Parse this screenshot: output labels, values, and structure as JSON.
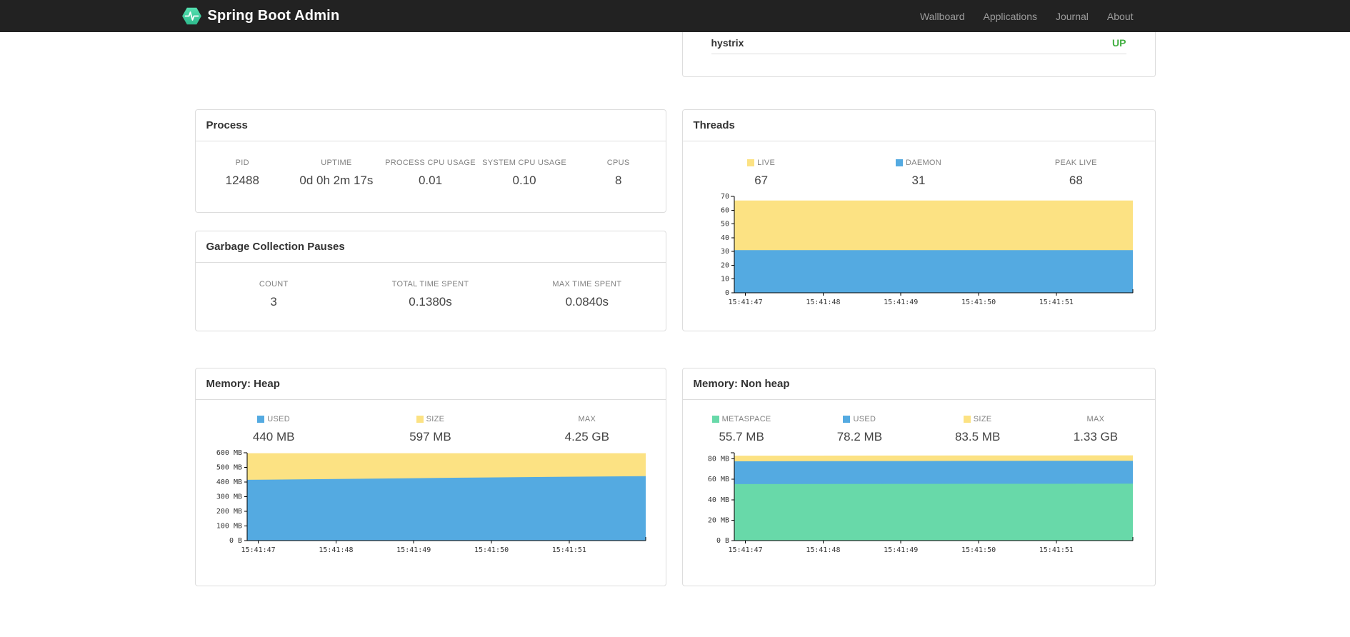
{
  "navbar": {
    "brand": "Spring Boot Admin",
    "items": [
      {
        "label": "Wallboard"
      },
      {
        "label": "Applications"
      },
      {
        "label": "Journal"
      },
      {
        "label": "About"
      }
    ]
  },
  "colors": {
    "navbar_bg": "#222222",
    "logo_green": "#41cda2",
    "status_up": "#44b044",
    "yellow": "#fce283",
    "blue": "#54aae1",
    "green": "#68d9a9",
    "panel_border": "#dddddd"
  },
  "application_panel": {
    "name": "hystrix",
    "status": "UP"
  },
  "process": {
    "title": "Process",
    "stats": [
      {
        "label": "PID",
        "value": "12488"
      },
      {
        "label": "UPTIME",
        "value": "0d 0h 2m 17s"
      },
      {
        "label": "PROCESS CPU USAGE",
        "value": "0.01"
      },
      {
        "label": "SYSTEM CPU USAGE",
        "value": "0.10"
      },
      {
        "label": "CPUS",
        "value": "8"
      }
    ]
  },
  "gc": {
    "title": "Garbage Collection Pauses",
    "stats": [
      {
        "label": "COUNT",
        "value": "3"
      },
      {
        "label": "TOTAL TIME SPENT",
        "value": "0.1380s"
      },
      {
        "label": "MAX TIME SPENT",
        "value": "0.0840s"
      }
    ]
  },
  "threads": {
    "title": "Threads",
    "stats": [
      {
        "label": "LIVE",
        "value": "67",
        "swatch": "#fce283"
      },
      {
        "label": "DAEMON",
        "value": "31",
        "swatch": "#54aae1"
      },
      {
        "label": "PEAK LIVE",
        "value": "68"
      }
    ]
  },
  "heap": {
    "title": "Memory: Heap",
    "stats": [
      {
        "label": "USED",
        "value": "440 MB",
        "swatch": "#54aae1"
      },
      {
        "label": "SIZE",
        "value": "597 MB",
        "swatch": "#fce283"
      },
      {
        "label": "MAX",
        "value": "4.25 GB"
      }
    ]
  },
  "nonheap": {
    "title": "Memory: Non heap",
    "stats": [
      {
        "label": "METASPACE",
        "value": "55.7 MB",
        "swatch": "#68d9a9"
      },
      {
        "label": "USED",
        "value": "78.2 MB",
        "swatch": "#54aae1"
      },
      {
        "label": "SIZE",
        "value": "83.5 MB",
        "swatch": "#fce283"
      },
      {
        "label": "MAX",
        "value": "1.33 GB"
      }
    ]
  },
  "chart_data": [
    {
      "id": "threads",
      "type": "area",
      "title": "Threads",
      "ymax": 70,
      "legend_position": "top",
      "grid": false,
      "y_ticks": [
        {
          "label": "70",
          "value": 70
        },
        {
          "label": "60",
          "value": 60
        },
        {
          "label": "50",
          "value": 50
        },
        {
          "label": "40",
          "value": 40
        },
        {
          "label": "30",
          "value": 30
        },
        {
          "label": "20",
          "value": 20
        },
        {
          "label": "10",
          "value": 10
        },
        {
          "label": "0",
          "value": 0
        }
      ],
      "x_ticks": [
        "15:41:47",
        "15:41:48",
        "15:41:49",
        "15:41:50",
        "15:41:51"
      ],
      "series": [
        {
          "name": "live",
          "color": "#fce283",
          "values": [
            67,
            67,
            67,
            67,
            67,
            67
          ]
        },
        {
          "name": "daemon",
          "color": "#54aae1",
          "values": [
            31,
            31,
            31,
            31,
            31,
            31
          ]
        }
      ]
    },
    {
      "id": "heap",
      "type": "area",
      "title": "Memory: Heap",
      "ymax": 600,
      "legend_position": "top",
      "grid": false,
      "y_ticks": [
        {
          "label": "600 MB",
          "value": 600
        },
        {
          "label": "500 MB",
          "value": 500
        },
        {
          "label": "400 MB",
          "value": 400
        },
        {
          "label": "300 MB",
          "value": 300
        },
        {
          "label": "200 MB",
          "value": 200
        },
        {
          "label": "100 MB",
          "value": 100
        },
        {
          "label": "0 B",
          "value": 0
        }
      ],
      "x_ticks": [
        "15:41:47",
        "15:41:48",
        "15:41:49",
        "15:41:50",
        "15:41:51"
      ],
      "series": [
        {
          "name": "size",
          "color": "#fce283",
          "values": [
            597,
            597,
            597,
            597,
            597,
            597
          ]
        },
        {
          "name": "used",
          "color": "#54aae1",
          "values": [
            415,
            420,
            426,
            431,
            436,
            440
          ]
        }
      ]
    },
    {
      "id": "nonheap",
      "type": "area",
      "title": "Memory: Non heap",
      "ymax": 86,
      "legend_position": "top",
      "grid": false,
      "y_ticks": [
        {
          "label": "80 MB",
          "value": 80
        },
        {
          "label": "60 MB",
          "value": 60
        },
        {
          "label": "40 MB",
          "value": 40
        },
        {
          "label": "20 MB",
          "value": 20
        },
        {
          "label": "0 B",
          "value": 0
        }
      ],
      "x_ticks": [
        "15:41:47",
        "15:41:48",
        "15:41:49",
        "15:41:50",
        "15:41:51"
      ],
      "series": [
        {
          "name": "size",
          "color": "#fce283",
          "values": [
            83.1,
            83.2,
            83.3,
            83.4,
            83.4,
            83.5
          ]
        },
        {
          "name": "used",
          "color": "#54aae1",
          "values": [
            77.6,
            77.8,
            77.9,
            78.0,
            78.1,
            78.2
          ]
        },
        {
          "name": "metaspace",
          "color": "#68d9a9",
          "values": [
            55.3,
            55.4,
            55.5,
            55.6,
            55.6,
            55.7
          ]
        }
      ]
    }
  ]
}
